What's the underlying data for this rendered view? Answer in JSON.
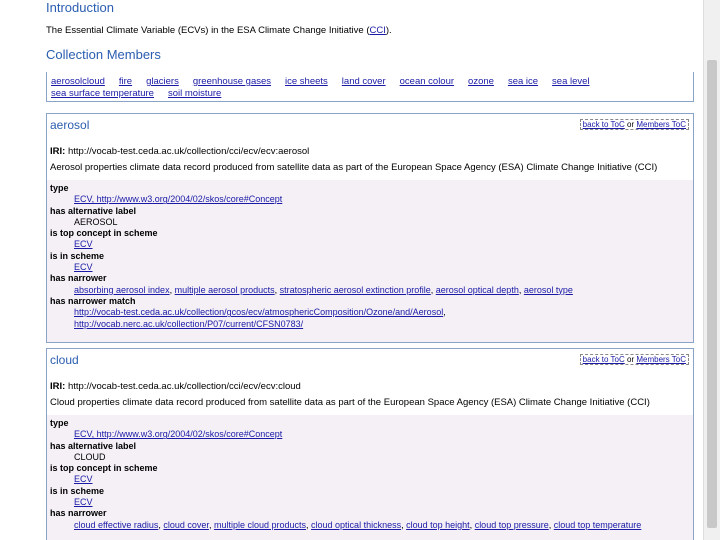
{
  "introduction": {
    "heading": "Introduction",
    "text": "The Essential Climate Variable (ECVs) in the ESA Climate Change Initiative (",
    "link": "CCI",
    "text_end": ")."
  },
  "members": {
    "heading": "Collection Members",
    "items": [
      "aerosol",
      "cloud",
      "fire",
      "glaciers",
      "greenhouse gases",
      "ice sheets",
      "land cover",
      "ocean colour",
      "ozone",
      "sea ice",
      "sea level",
      "sea surface temperature",
      "soil moisture"
    ]
  },
  "nav": {
    "back_toc": "back to ToC",
    "or": " or ",
    "members_toc": "Members ToC"
  },
  "labels": {
    "iri": "IRI:",
    "type": "type",
    "alt_label": "has alternative label",
    "top_concept": "is top concept in scheme",
    "in_scheme": "is in scheme",
    "narrower": "has narrower",
    "narrower_match": "has narrower match"
  },
  "sections": [
    {
      "title": "aerosol",
      "iri": "http://vocab-test.ceda.ac.uk/collection/cci/ecv/ecv:aerosol",
      "description": "Aerosol properties climate data record produced from satellite data as part of the European Space Agency (ESA) Climate Change Initiative (CCI)",
      "type_value": "ECV, http://www.w3.org/2004/02/skos/core#Concept",
      "alt_label": "AEROSOL",
      "top_concept": "ECV",
      "in_scheme": "ECV",
      "narrower": [
        "absorbing aerosol index",
        "multiple aerosol products",
        "stratospheric aerosol extinction profile",
        "aerosol optical depth",
        "aerosol type"
      ],
      "narrower_match": [
        "http://vocab-test.ceda.ac.uk/collection/gcos/ecv/atmosphericComposition/Ozone/and/Aerosol",
        "http://vocab.nerc.ac.uk/collection/P07/current/CFSN0783/"
      ]
    },
    {
      "title": "cloud",
      "iri": "http://vocab-test.ceda.ac.uk/collection/cci/ecv/ecv:cloud",
      "description": "Cloud properties climate data record produced from satellite data as part of the European Space Agency (ESA) Climate Change Initiative (CCI)",
      "type_value": "ECV, http://www.w3.org/2004/02/skos/core#Concept",
      "alt_label": "CLOUD",
      "top_concept": "ECV",
      "in_scheme": "ECV",
      "narrower": [
        "cloud effective radius",
        "cloud cover",
        "multiple cloud products",
        "cloud optical thickness",
        "cloud top height",
        "cloud top pressure",
        "cloud top temperature"
      ]
    }
  ]
}
